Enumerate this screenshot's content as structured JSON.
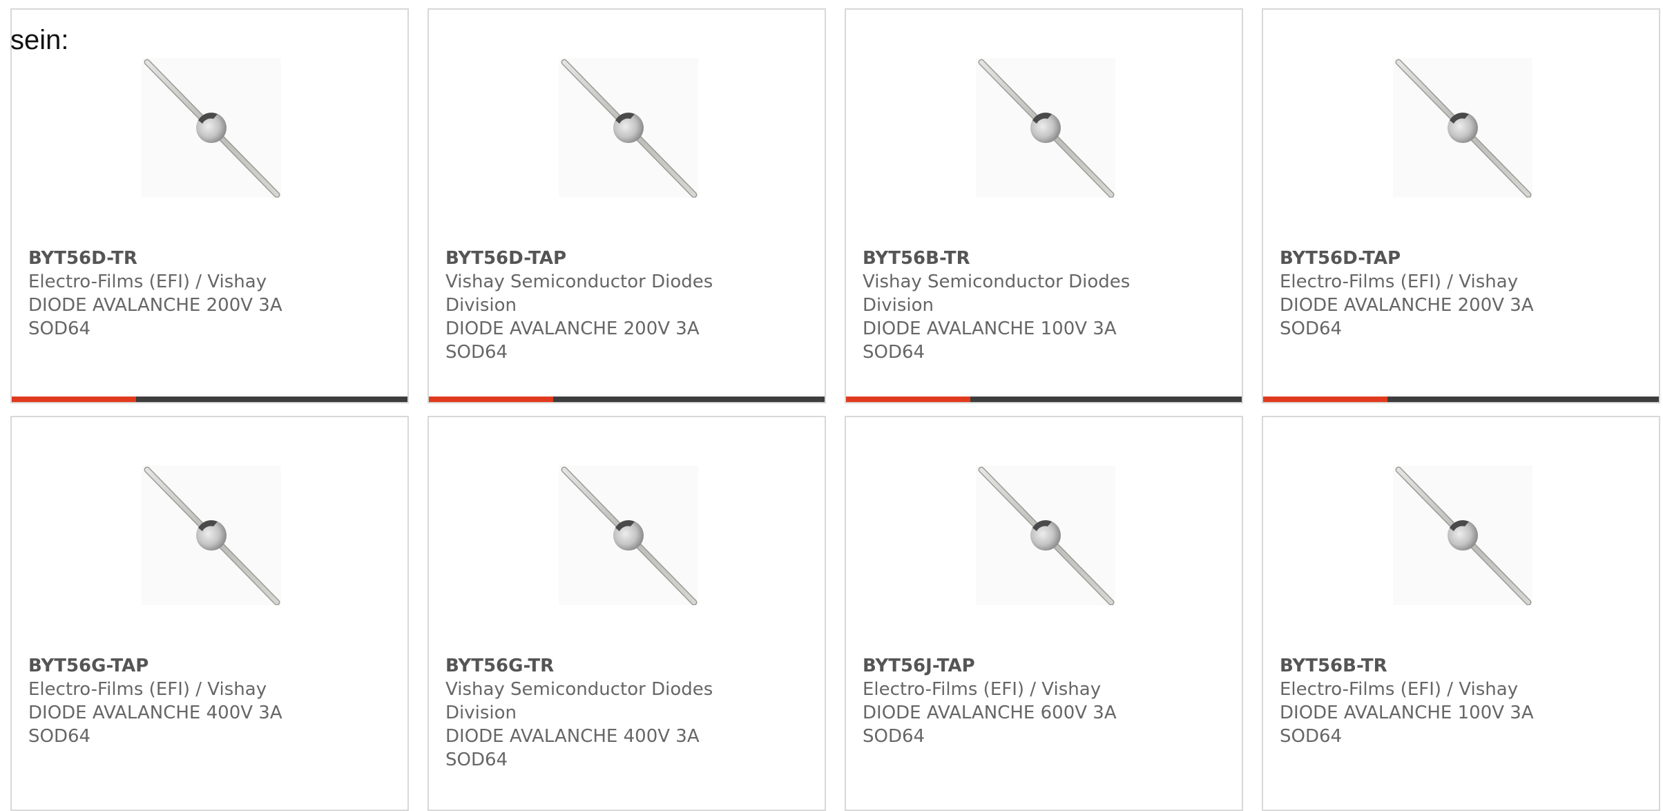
{
  "heading": "sein:",
  "colors": {
    "accent": "#e03a1e",
    "bar": "#3d3d3d",
    "text": "#666666"
  },
  "products": [
    {
      "part": "BYT56D-TR",
      "lines": [
        "Electro-Films (EFI) / Vishay",
        "DIODE AVALANCHE 200V 3A",
        "SOD64"
      ],
      "icon": "diode-axial-image"
    },
    {
      "part": "BYT56D-TAP",
      "lines": [
        "Vishay Semiconductor Diodes",
        "Division",
        "DIODE AVALANCHE 200V 3A",
        "SOD64"
      ],
      "icon": "diode-axial-image"
    },
    {
      "part": "BYT56B-TR",
      "lines": [
        "Vishay Semiconductor Diodes",
        "Division",
        "DIODE AVALANCHE 100V 3A",
        "SOD64"
      ],
      "icon": "diode-axial-image"
    },
    {
      "part": "BYT56D-TAP",
      "lines": [
        "Electro-Films (EFI) / Vishay",
        "DIODE AVALANCHE 200V 3A",
        "SOD64"
      ],
      "icon": "diode-axial-image"
    },
    {
      "part": "BYT56G-TAP",
      "lines": [
        "Electro-Films (EFI) / Vishay",
        "DIODE AVALANCHE 400V 3A",
        "SOD64"
      ],
      "icon": "diode-axial-image"
    },
    {
      "part": "BYT56G-TR",
      "lines": [
        "Vishay Semiconductor Diodes",
        "Division",
        "DIODE AVALANCHE 400V 3A",
        "SOD64"
      ],
      "icon": "diode-axial-image"
    },
    {
      "part": "BYT56J-TAP",
      "lines": [
        "Electro-Films (EFI) / Vishay",
        "DIODE AVALANCHE 600V 3A",
        "SOD64"
      ],
      "icon": "diode-axial-image"
    },
    {
      "part": "BYT56B-TR",
      "lines": [
        "Electro-Films (EFI) / Vishay",
        "DIODE AVALANCHE 100V 3A",
        "SOD64"
      ],
      "icon": "diode-axial-image"
    }
  ]
}
